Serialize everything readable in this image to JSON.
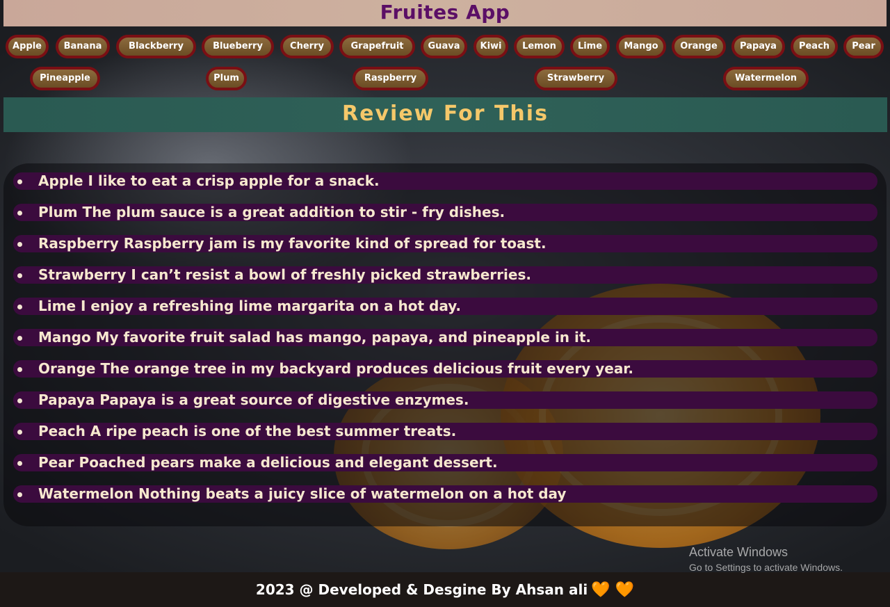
{
  "app": {
    "title": "Fruites App"
  },
  "fruits": [
    "Apple",
    "Banana",
    "Blackberry",
    "Blueberry",
    "Cherry",
    "Grapefruit",
    "Guava",
    "Kiwi",
    "Lemon",
    "Lime",
    "Mango",
    "Orange",
    "Papaya",
    "Peach",
    "Pear",
    "Pineapple",
    "Plum",
    "Raspberry",
    "Strawberry",
    "Watermelon"
  ],
  "review_section": {
    "title": "Review For This"
  },
  "reviews": [
    "Apple I like to eat a crisp apple for a snack.",
    "Plum The plum sauce is a great addition to stir - fry dishes.",
    "Raspberry Raspberry jam is my favorite kind of spread for toast.",
    "Strawberry I can’t resist a bowl of freshly picked strawberries.",
    "Lime I enjoy a refreshing lime margarita on a hot day.",
    "Mango My favorite fruit salad has mango, papaya, and pineapple in it.",
    "Orange The orange tree in my backyard produces delicious fruit every year.",
    "Papaya Papaya is a great source of digestive enzymes.",
    "Peach A ripe peach is one of the best summer treats.",
    "Pear Poached pears make a delicious and elegant dessert.",
    "Watermelon Nothing beats a juicy slice of watermelon on a hot day"
  ],
  "watermark": {
    "line1": "Activate Windows",
    "line2": "Go to Settings to activate Windows."
  },
  "footer": {
    "text": "2023 @ Developed & Desgine By Ahsan ali",
    "hearts": "🧡 🧡"
  },
  "colors": {
    "header_bg": "#c9a799",
    "title": "#5b0f66",
    "pill_border": "#7a0f14",
    "pill_fill": "#7a5a30",
    "banner_bg": "#2a5a52",
    "banner_text": "#f5c86a",
    "review_row": "#3b0b3e",
    "footer_bg": "#1d1816",
    "heart": "#f07a18"
  }
}
